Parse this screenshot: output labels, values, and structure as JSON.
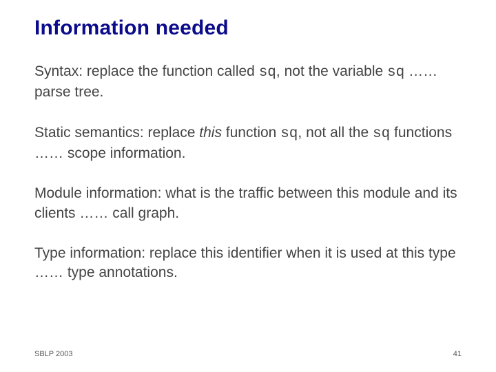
{
  "title": "Information needed",
  "p1": {
    "lead": "Syntax: replace the function called ",
    "code1": "sq",
    "mid1": ", not the variable ",
    "code2": "sq",
    "tail": "  …… parse tree."
  },
  "p2": {
    "lead": "Static semantics: replace ",
    "ital": "this",
    "mid1": " function ",
    "code1": "sq",
    "mid2": ", not all the ",
    "code2": "sq",
    "tail": " functions …… scope information."
  },
  "p3": {
    "text": "Module information: what is the traffic between this module and its clients …… call graph."
  },
  "p4": {
    "text": "Type information: replace this identifier when it is used at this type …… type annotations."
  },
  "footer": {
    "conference": "SBLP 2003",
    "page": "41"
  }
}
